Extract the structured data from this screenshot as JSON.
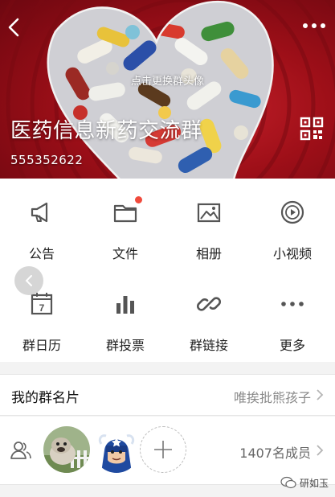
{
  "header": {
    "change_avatar_text": "点击更换群头像",
    "group_name": "医药信息新药交流群",
    "group_id": "555352622",
    "colors": {
      "background": "#a51420",
      "text": "#ffffff"
    }
  },
  "icons": {
    "back": "back-arrow-icon",
    "more": "more-dots-icon",
    "qr": "qr-code-icon"
  },
  "features": [
    {
      "label": "公告",
      "icon": "megaphone-icon"
    },
    {
      "label": "文件",
      "icon": "folder-icon",
      "badge": true
    },
    {
      "label": "相册",
      "icon": "photo-album-icon"
    },
    {
      "label": "小视频",
      "icon": "video-icon"
    },
    {
      "label": "群日历",
      "icon": "calendar-icon",
      "calendar_day": "7"
    },
    {
      "label": "群投票",
      "icon": "bar-chart-icon"
    },
    {
      "label": "群链接",
      "icon": "link-icon"
    },
    {
      "label": "更多",
      "icon": "more-icon"
    }
  ],
  "group_card": {
    "title": "我的群名片",
    "value": "唯挨批熊孩子"
  },
  "members": {
    "count_text": "1407名成员"
  },
  "watermark": {
    "text": "研如玉"
  },
  "colors": {
    "badge": "#f04a3c",
    "icon": "#555555",
    "accent_text": "#8a8a8a"
  }
}
